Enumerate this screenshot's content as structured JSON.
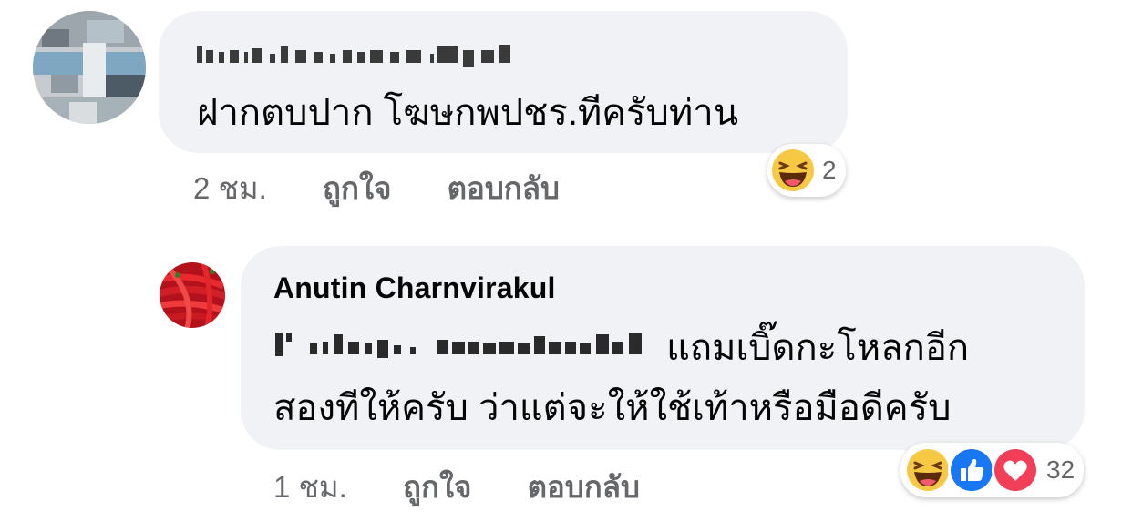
{
  "comments": [
    {
      "author": "",
      "text": "ฝากตบปาก โฆษกพปชร.ทีครับท่าน",
      "time": "2 ชม.",
      "like_label": "ถูกใจ",
      "reply_label": "ตอบกลับ",
      "reaction_count": "2",
      "reactions": [
        "haha-icon"
      ]
    },
    {
      "author": "Anutin Charnvirakul",
      "text_line1": "แถมเบิ๊ดกะโหลกอีก",
      "text_line2": "สองทีให้ครับ ว่าแต่จะให้ใช้เท้าหรือมือดีครับ",
      "time": "1 ชม.",
      "like_label": "ถูกใจ",
      "reply_label": "ตอบกลับ",
      "reaction_count": "32",
      "reactions": [
        "haha-icon",
        "like-icon",
        "love-icon"
      ]
    }
  ]
}
